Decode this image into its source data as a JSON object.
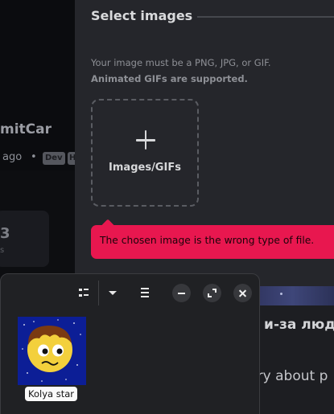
{
  "background": {
    "name": "mitCar",
    "time": "ago",
    "dot": "•",
    "badge_dev": "Dev",
    "badge_h": "H",
    "stat": "3",
    "stat_sub": "s",
    "right_text_1": "s и-за люд",
    "right_text_2": "rry about p"
  },
  "dialog": {
    "title": "Select images",
    "hint_line1": "Your image must be a PNG, JPG, or GIF.",
    "hint_line2": "Animated GIFs are supported.",
    "dropzone_label": "Images/GIFs",
    "dropzone_icon": "plus-icon",
    "error": "The chosen image is the wrong type of file."
  },
  "file_manager": {
    "toolbar": {
      "view_icon": "list-view-icon",
      "dropdown_icon": "chevron-down-icon",
      "menu_icon": "hamburger-menu-icon",
      "minimize_icon": "minimize-icon",
      "maximize_icon": "maximize-icon",
      "close_icon": "close-icon"
    },
    "files": [
      {
        "name": "Kolya star"
      }
    ]
  },
  "colors": {
    "dialog_bg": "#25262b",
    "error_bg": "#e8174f",
    "file_manager_bg": "#202124"
  }
}
